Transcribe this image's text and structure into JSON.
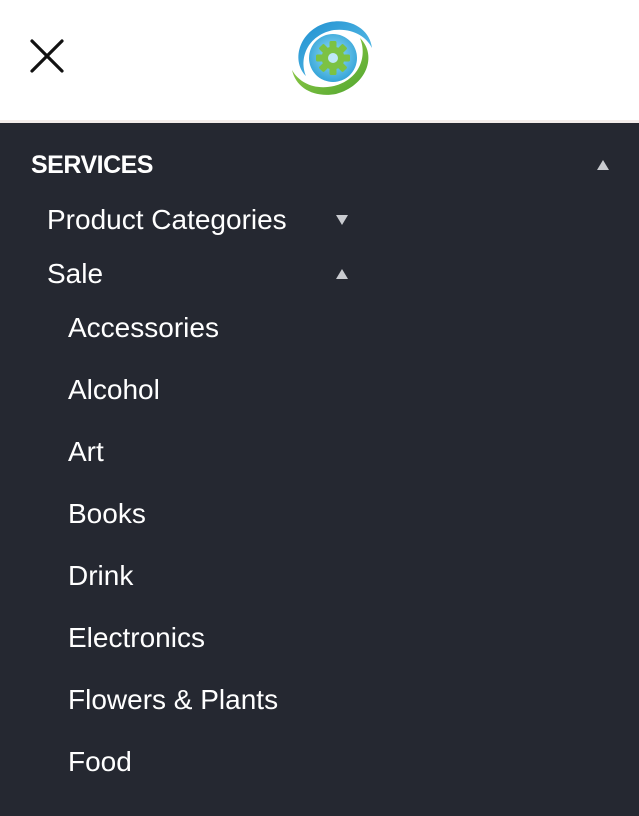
{
  "header": {
    "close_icon": "close-icon",
    "logo_icon": "gear-logo-icon",
    "colors": {
      "background": "#ffffff",
      "logo_green": "#7cc243",
      "logo_blue": "#2ea3d8"
    }
  },
  "menu": {
    "colors": {
      "background": "#252831",
      "text": "#ffffff",
      "caret": "#c9cbd0"
    },
    "section": {
      "title": "SERVICES",
      "state": "expanded"
    },
    "groups": [
      {
        "label": "Product Categories",
        "state": "collapsed"
      },
      {
        "label": "Sale",
        "state": "expanded"
      }
    ],
    "sale_items": [
      {
        "label": "Accessories"
      },
      {
        "label": "Alcohol"
      },
      {
        "label": "Art"
      },
      {
        "label": "Books"
      },
      {
        "label": "Drink"
      },
      {
        "label": "Electronics"
      },
      {
        "label": "Flowers & Plants"
      },
      {
        "label": "Food"
      }
    ]
  }
}
